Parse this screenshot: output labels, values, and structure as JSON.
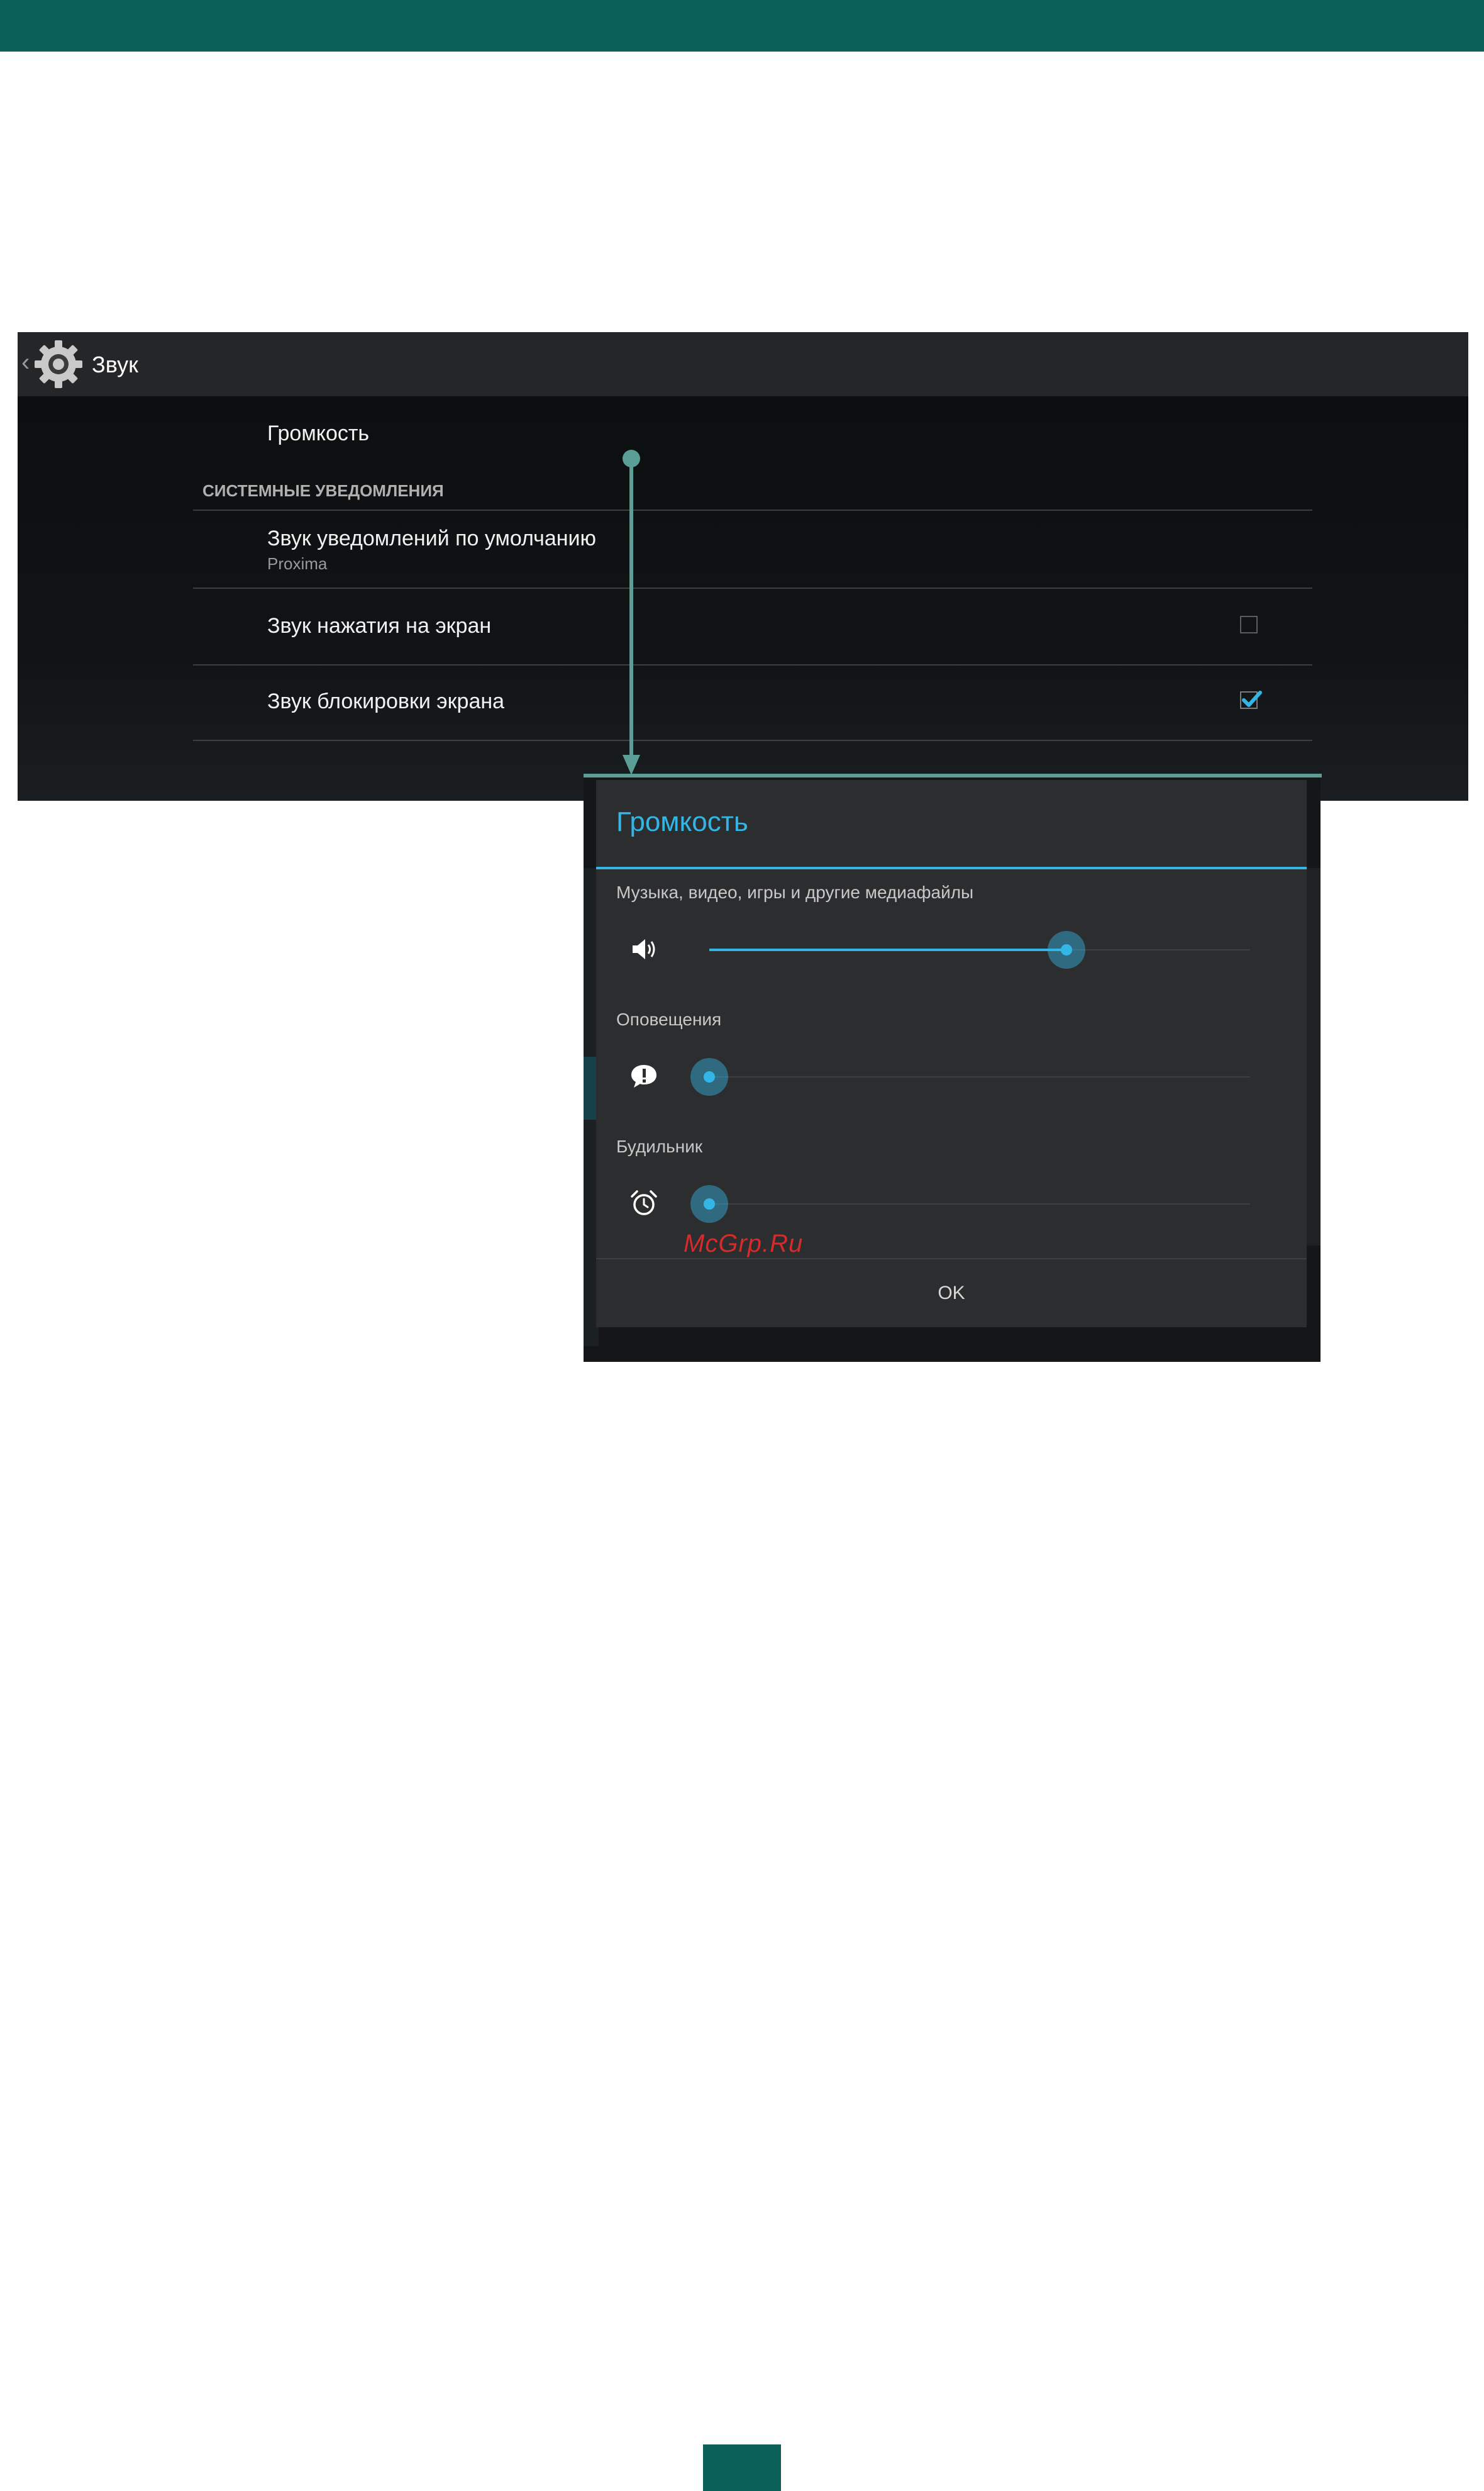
{
  "settings_screen": {
    "action_bar": {
      "title": "Звук",
      "icon": "settings-gear-icon"
    },
    "volume_row": {
      "title": "Громкость"
    },
    "section_header": "СИСТЕМНЫЕ УВЕДОМЛЕНИЯ",
    "rows": [
      {
        "title": "Звук уведомлений по умолчанию",
        "subtitle": "Proxima"
      },
      {
        "title": "Звук нажатия на экран",
        "checked": false
      },
      {
        "title": "Звук блокировки экрана",
        "checked": true
      }
    ]
  },
  "volume_dialog": {
    "title": "Громкость",
    "accent_color": "#33b5e5",
    "sliders": [
      {
        "label": "Музыка, видео, игры и другие медиафайлы",
        "icon": "speaker-icon",
        "level": 0.66
      },
      {
        "label": "Оповещения",
        "icon": "notification-icon",
        "level": 0.0
      },
      {
        "label": "Будильник",
        "icon": "alarm-clock-icon",
        "level": 0.0
      }
    ],
    "ok_label": "OK"
  },
  "watermark": "McGrp.Ru",
  "colors": {
    "brand_teal": "#0b6158",
    "connector": "#5a9e97"
  }
}
